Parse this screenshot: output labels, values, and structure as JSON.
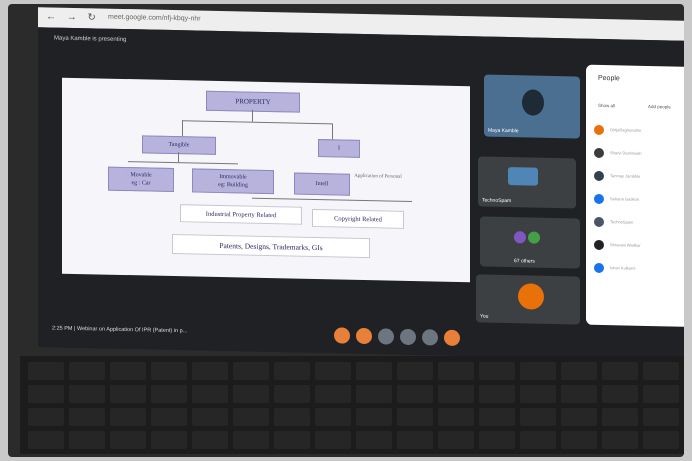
{
  "browser": {
    "nav_icons": "← → ↻",
    "url": "meet.google.com/nfj-kbqy-nhr"
  },
  "meeting": {
    "presenting_text": "Maya Kamble is presenting",
    "time": "2:25 PM",
    "title": "Webinar on Application Of IPR (Patent) in p..."
  },
  "slide": {
    "property": "PROPERTY",
    "tangible": "Tangible",
    "intangible": "I",
    "movable": "Movable\neg : Car",
    "immovable": "Immovable\neg: Building",
    "intellectual": "Intell",
    "overlap_text": "Application of Personal",
    "industrial": "Industrial Property Related",
    "copyright": "Copyright Related",
    "examples": "Patents, Designs, Trademarks, GIs"
  },
  "tiles": {
    "presenter_name": "Maya Kamble",
    "techno_name": "TechnoSpam",
    "others": "67 others",
    "you": "You"
  },
  "people": {
    "title": "People",
    "tab_all": "Show all",
    "tab_other": "Add people",
    "members": [
      {
        "name": "GirijaRaghunathe",
        "color": "#e8710a"
      },
      {
        "name": "Sharvi Deshmukh",
        "color": "#3c3c3c"
      },
      {
        "name": "Tanmay Jambhle",
        "color": "#33404f"
      },
      {
        "name": "Sahana Gadkari",
        "color": "#1a73e8"
      },
      {
        "name": "TechnoSpam",
        "color": "#4a5568"
      },
      {
        "name": "Shravani Wadkar",
        "color": "#202124"
      },
      {
        "name": "Ishan Kulkarni",
        "color": "#1a73e8"
      }
    ]
  },
  "controls": {
    "colors": [
      "#e8803a",
      "#e8803a",
      "#6d7580",
      "#6d7580",
      "#6d7580",
      "#e8803a"
    ]
  }
}
